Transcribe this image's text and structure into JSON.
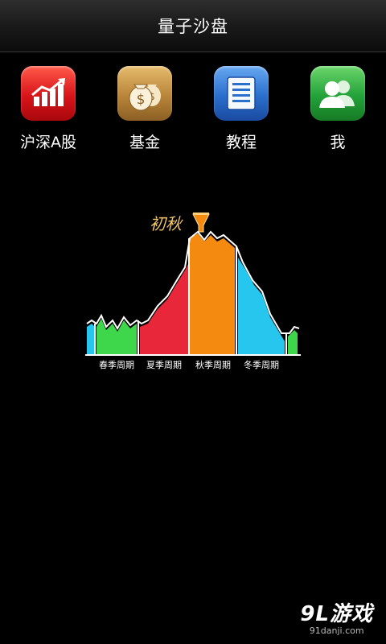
{
  "app": {
    "title": "量子沙盘"
  },
  "icons": [
    {
      "label": "沪深A股",
      "icon": "stock-chart-icon",
      "color": "#e31b1b"
    },
    {
      "label": "基金",
      "icon": "money-bag-icon",
      "color": "#b9853a"
    },
    {
      "label": "教程",
      "icon": "document-icon",
      "color": "#2a6fcc"
    },
    {
      "label": "我",
      "icon": "users-icon",
      "color": "#23a23a"
    }
  ],
  "cycle": {
    "marker_label": "初秋",
    "marker_icon": "funnel-icon",
    "phases": [
      {
        "label": "春季周期",
        "color": "#3ed64a"
      },
      {
        "label": "夏季周期",
        "color": "#e8283a"
      },
      {
        "label": "秋季周期",
        "color": "#f58a10"
      },
      {
        "label": "冬季周期",
        "color": "#27c6ee"
      }
    ]
  },
  "watermark": {
    "main": "9L游戏",
    "sub": "91danji.com"
  }
}
